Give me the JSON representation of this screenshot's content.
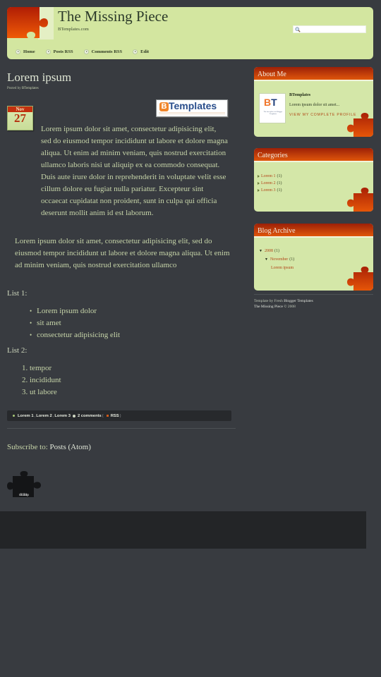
{
  "header": {
    "title": "The Missing Piece",
    "description": "BTemplates.com",
    "search_placeholder": "",
    "nav": [
      {
        "label": "Home"
      },
      {
        "label": "Posts RSS"
      },
      {
        "label": "Comments RSS"
      },
      {
        "label": "Edit"
      }
    ]
  },
  "post": {
    "title": "Lorem ipsum",
    "posted_by_label": "Posted by",
    "author": "BTemplates",
    "date": {
      "month": "Nov",
      "day": "27"
    },
    "banner_text": "Templates",
    "banner_logo": "B",
    "paragraph1": "Lorem ipsum dolor sit amet, consectetur adipisicing elit, sed do eiusmod tempor incididunt ut labore et dolore magna aliqua. Ut enim ad minim veniam, quis nostrud exercitation ullamco laboris nisi ut aliquip ex ea commodo consequat. Duis aute irure dolor in reprehenderit in voluptate velit esse cillum dolore eu fugiat nulla pariatur. Excepteur sint occaecat cupidatat non proident, sunt in culpa qui officia deserunt mollit anim id est laborum.",
    "paragraph2": "Lorem ipsum dolor sit amet, consectetur adipisicing elit, sed do eiusmod tempor incididunt ut labore et dolore magna aliqua. Ut enim ad minim veniam, quis nostrud exercitation ullamco",
    "list1_label": "List 1:",
    "list1": [
      "Lorem ipsum dolor",
      "sit amet",
      "consectetur adipisicing elit"
    ],
    "list2_label": "List 2:",
    "list2": [
      "1. tempor",
      "2. incididunt",
      "3. ut labore"
    ],
    "footer": {
      "labels": [
        "Lorem 1",
        "Lorem 2",
        "Lorem 3"
      ],
      "comments": "2 comments",
      "rss": "RSS"
    }
  },
  "subscribe": {
    "label": "Subscribe to:",
    "link": "Posts (Atom)"
  },
  "back_to_top": {
    "line1": "Back",
    "line2": "to Top"
  },
  "sidebar": {
    "about": {
      "title": "About Me",
      "name": "BTemplates",
      "text": "Lorem ipsum dolor sit amet...",
      "profile_link": "VIEW MY COMPLETE PROFILE",
      "avatar_caption": "The best place for Blogger Templates"
    },
    "categories": {
      "title": "Categories",
      "items": [
        {
          "label": "Lorem 1",
          "count": "(1)"
        },
        {
          "label": "Lorem 2",
          "count": "(1)"
        },
        {
          "label": "Lorem 3",
          "count": "(1)"
        }
      ]
    },
    "archive": {
      "title": "Blog Archive",
      "year": {
        "label": "2008",
        "count": "(1)",
        "toggle": "▼"
      },
      "month": {
        "label": "November",
        "count": "(1)",
        "toggle": "▼"
      },
      "post": "Lorem ipsum"
    },
    "credits": {
      "prefix": "Template by Fresh",
      "link1": "Blogger Templates",
      "link2": "The Missing Piece",
      "suffix": "© 2008"
    }
  },
  "colors": {
    "background": "#383b40",
    "header_bg": "#d3e6a0",
    "accent_orange": "#e0570a",
    "widget_bg": "#d4e7a8",
    "footer_band": "#232527"
  }
}
